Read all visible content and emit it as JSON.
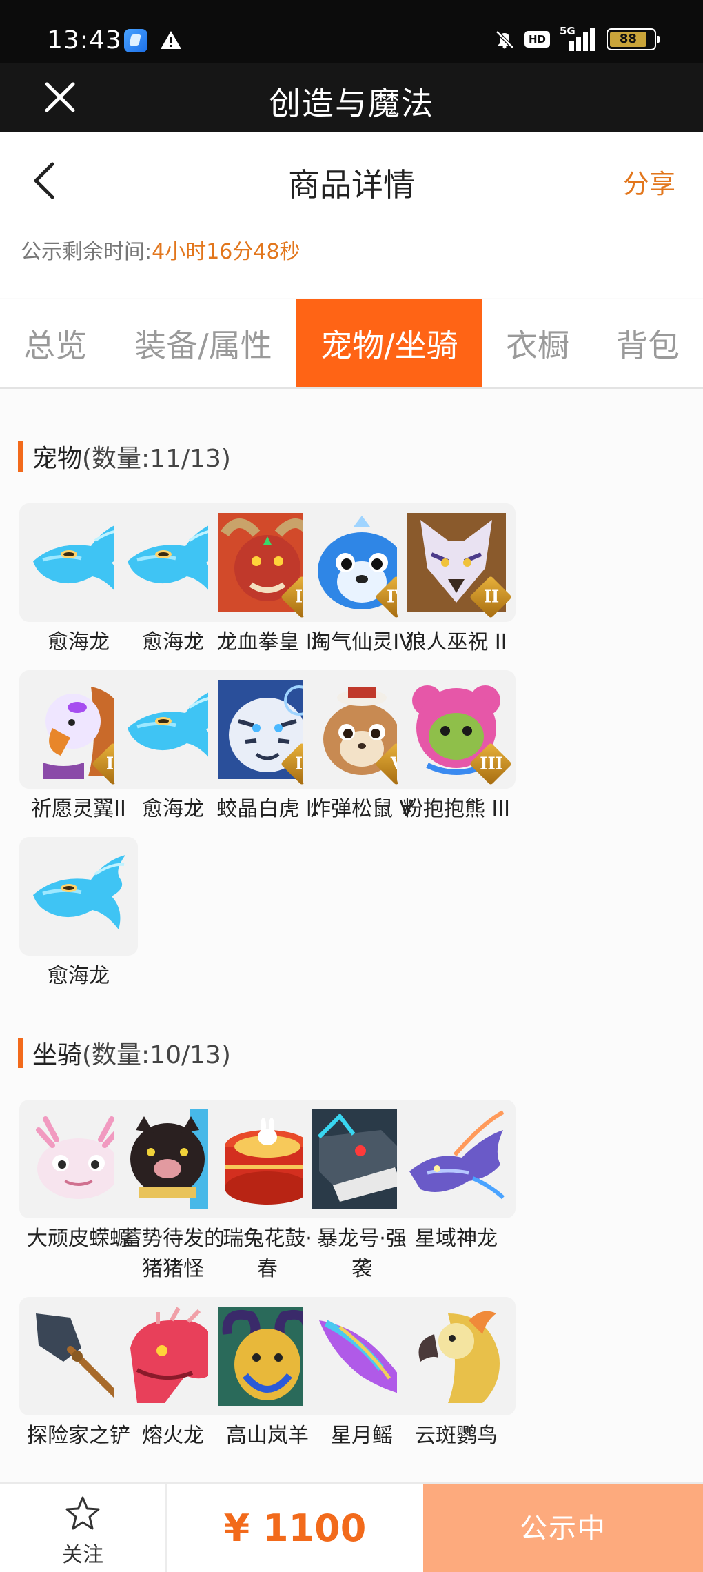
{
  "status_bar": {
    "time": "13:43",
    "network": "5G",
    "hd_label": "HD",
    "battery": "88",
    "battery_level_percent": 88
  },
  "app_bar": {
    "title": "创造与魔法",
    "close_icon": "close-icon"
  },
  "page_header": {
    "title": "商品详情",
    "share_label": "分享",
    "back_icon": "chevron-left-icon"
  },
  "countdown": {
    "label": "公示剩余时间:",
    "value": "4小时16分48秒"
  },
  "tabs": [
    {
      "label": "总览",
      "active": false
    },
    {
      "label": "装备/属性",
      "active": false
    },
    {
      "label": "宠物/坐骑",
      "active": true
    },
    {
      "label": "衣橱",
      "active": false
    },
    {
      "label": "背包",
      "active": false
    }
  ],
  "pets": {
    "title": "宠物",
    "count": "(数量:11/13)",
    "items": [
      {
        "name": "愈海龙",
        "icon": "sea-dragon",
        "tier": ""
      },
      {
        "name": "愈海龙",
        "icon": "sea-dragon",
        "tier": ""
      },
      {
        "name": "龙血拳皇 II",
        "icon": "red-ogre",
        "tier": "II"
      },
      {
        "name": "淘气仙灵IV",
        "icon": "blue-seal",
        "tier": "IV"
      },
      {
        "name": "狼人巫祝 II",
        "icon": "wolf-shaman",
        "tier": "II"
      },
      {
        "name": "祈愿灵翼II",
        "icon": "griffin",
        "tier": "II"
      },
      {
        "name": "愈海龙",
        "icon": "sea-dragon",
        "tier": ""
      },
      {
        "name": "蛟晶白虎 II",
        "icon": "white-tiger",
        "tier": "II"
      },
      {
        "name": "炸弹松鼠 V",
        "icon": "squirrel",
        "tier": "V"
      },
      {
        "name": "粉抱抱熊 III",
        "icon": "pink-bear",
        "tier": "III"
      },
      {
        "name": "愈海龙",
        "icon": "sea-dragon",
        "tier": ""
      }
    ]
  },
  "mounts": {
    "title": "坐骑",
    "count": "(数量:10/13)",
    "items": [
      {
        "name": "大顽皮蝾螈",
        "icon": "axolotl"
      },
      {
        "name": "蓄势待发的\n猪猪怪",
        "icon": "pig"
      },
      {
        "name": "瑞兔花鼓·\n春",
        "icon": "drum"
      },
      {
        "name": "暴龙号·强\n袭",
        "icon": "mech-rex"
      },
      {
        "name": "星域神龙",
        "icon": "star-dragon"
      },
      {
        "name": "探险家之铲",
        "icon": "shovel"
      },
      {
        "name": "熔火龙",
        "icon": "lava-dragon"
      },
      {
        "name": "高山岚羊",
        "icon": "mountain-goat"
      },
      {
        "name": "星月鳐",
        "icon": "star-ray"
      },
      {
        "name": "云斑鹦鸟",
        "icon": "parrot"
      }
    ]
  },
  "bottom_bar": {
    "follow_label": "关注",
    "follow_icon": "star-outline-icon",
    "price": "¥ 1100",
    "status_label": "公示中"
  },
  "colors": {
    "accent": "#ff6415",
    "price": "#f26a1b",
    "status_button": "#fdaa7d"
  }
}
